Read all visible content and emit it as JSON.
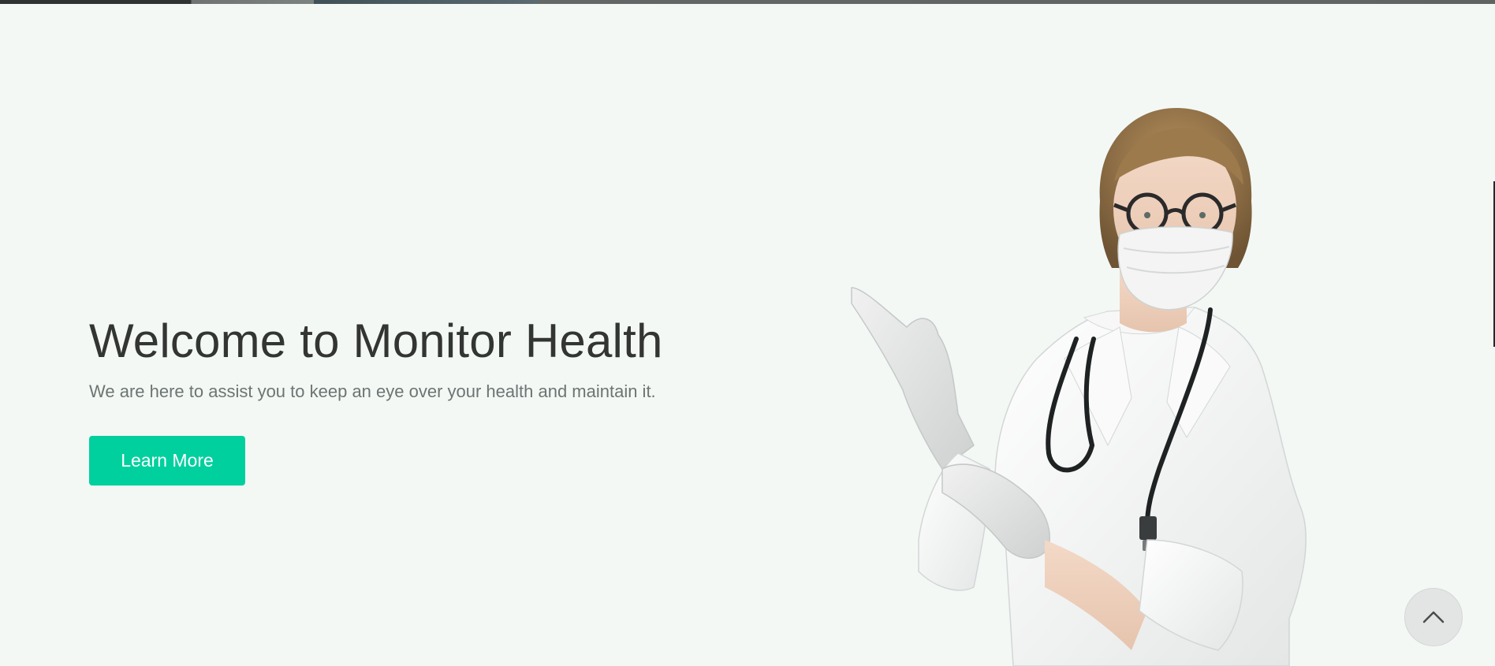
{
  "hero": {
    "title": "Welcome to Monitor Health",
    "subtitle": "We are here to assist you to keep an eye over your health and maintain it.",
    "cta_label": "Learn More"
  },
  "colors": {
    "background": "#f3f8f5",
    "accent": "#00d09e",
    "title_text": "#333533",
    "subtitle_text": "#6c7572"
  },
  "icons": {
    "scroll_top": "chevron-up-icon",
    "hero_image": "doctor-image"
  }
}
